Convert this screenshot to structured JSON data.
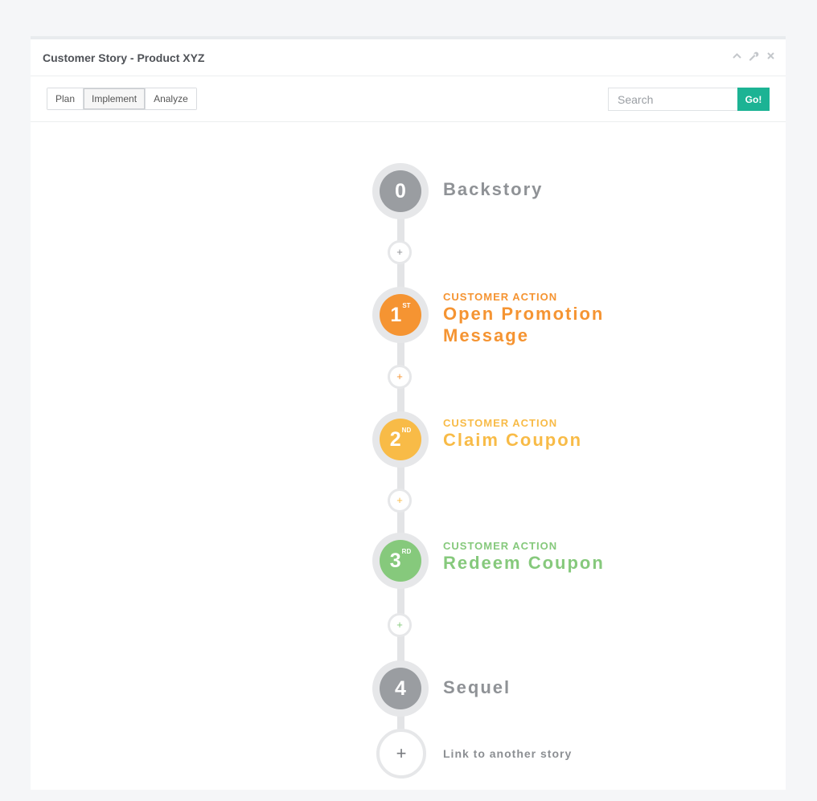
{
  "panel": {
    "title": "Customer Story - Product XYZ",
    "tools": [
      "chevron-up-icon",
      "wrench-icon",
      "close-icon"
    ]
  },
  "toolbar": {
    "tabs": [
      {
        "label": "Plan",
        "active": false
      },
      {
        "label": "Implement",
        "active": true
      },
      {
        "label": "Analyze",
        "active": false
      }
    ],
    "search": {
      "placeholder": "Search",
      "value": ""
    },
    "go_label": "Go!"
  },
  "timeline": {
    "steps": [
      {
        "number": "0",
        "suffix": "",
        "subtitle": "",
        "title": "Backstory",
        "color": "#9a9da1"
      },
      {
        "number": "1",
        "suffix": "ST",
        "subtitle": "CUSTOMER ACTION",
        "title_line1": "Open Promotion",
        "title_line2": "Message",
        "color": "#f59432"
      },
      {
        "number": "2",
        "suffix": "ND",
        "subtitle": "CUSTOMER ACTION",
        "title": "Claim Coupon",
        "color": "#f8bb47"
      },
      {
        "number": "3",
        "suffix": "RD",
        "subtitle": "CUSTOMER ACTION",
        "title": "Redeem Coupon",
        "color": "#86c97c"
      },
      {
        "number": "4",
        "suffix": "",
        "subtitle": "",
        "title": "Sequel",
        "color": "#9a9da1"
      }
    ],
    "add_glyph": "+",
    "link_glyph": "+",
    "link_label": "Link to another story"
  }
}
